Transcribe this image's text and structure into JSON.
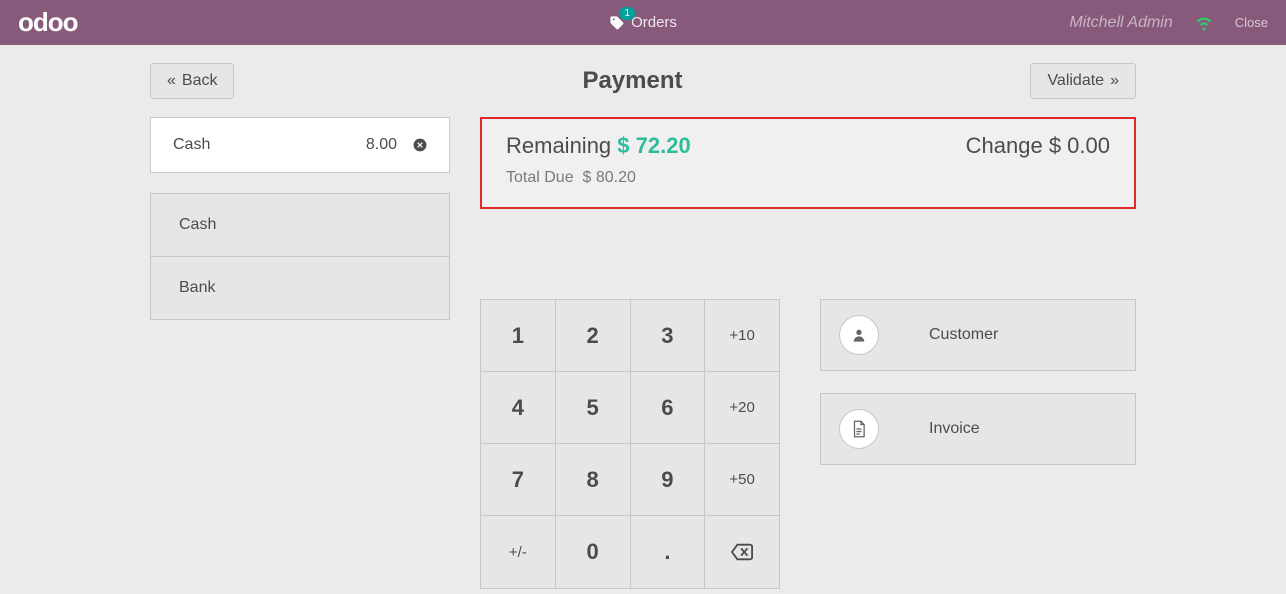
{
  "topbar": {
    "logo": "odoo",
    "orders_label": "Orders",
    "orders_count": "1",
    "user": "Mitchell Admin",
    "close": "Close"
  },
  "header": {
    "back": "Back",
    "title": "Payment",
    "validate": "Validate"
  },
  "payment_line": {
    "method": "Cash",
    "amount": "8.00"
  },
  "methods": [
    "Cash",
    "Bank"
  ],
  "summary": {
    "remaining_label": "Remaining",
    "remaining_value": "$ 72.20",
    "total_due_label": "Total Due",
    "total_due_value": "$ 80.20",
    "change_label": "Change",
    "change_value": "$ 0.00"
  },
  "numpad": {
    "r0": [
      "1",
      "2",
      "3",
      "+10"
    ],
    "r1": [
      "4",
      "5",
      "6",
      "+20"
    ],
    "r2": [
      "7",
      "8",
      "9",
      "+50"
    ],
    "r3": [
      "+/-",
      "0",
      ".",
      "⌫"
    ]
  },
  "side": {
    "customer": "Customer",
    "invoice": "Invoice"
  }
}
